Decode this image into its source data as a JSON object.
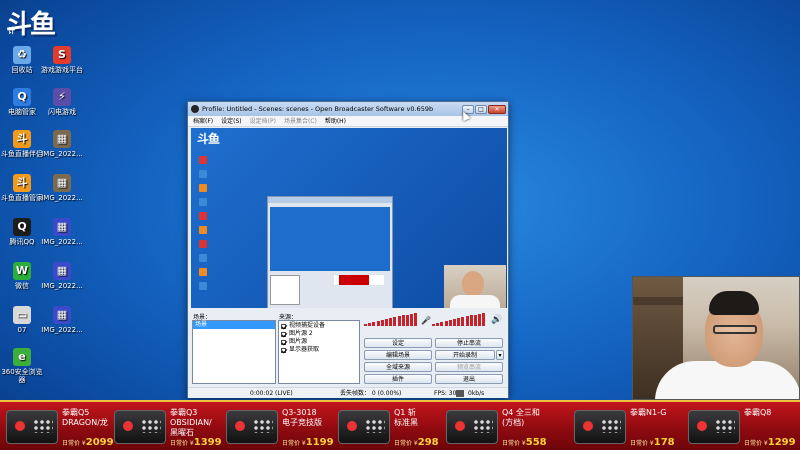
{
  "desktop": {
    "logo_text": "斗鱼",
    "logo_sub": "计",
    "icons": [
      {
        "label": "回收站",
        "icon": "recycle-bin-icon",
        "color": "#6aa8e8",
        "glyph": "♻"
      },
      {
        "label": "游戏游戏平台",
        "icon": "game-platform-icon",
        "color": "#e33c2c",
        "glyph": "S"
      },
      {
        "label": "电脑管家",
        "icon": "pc-manager-icon",
        "color": "#2e7de0",
        "glyph": "Q"
      },
      {
        "label": "闪电游戏",
        "icon": "lightning-game-icon",
        "color": "#5b4ea8",
        "glyph": "⚡"
      },
      {
        "label": "斗鱼直播伴侣",
        "icon": "douyu-companion-icon",
        "color": "#f39a1c",
        "glyph": "斗"
      },
      {
        "label": "IMG_2022...",
        "icon": "image-file-icon",
        "color": "#7a6a52",
        "glyph": "▦"
      },
      {
        "label": "斗鱼直播管家",
        "icon": "douyu-manager-icon",
        "color": "#f39a1c",
        "glyph": "斗"
      },
      {
        "label": "IMG_2022...",
        "icon": "image-file-icon",
        "color": "#7a6a52",
        "glyph": "▦"
      },
      {
        "label": "腾讯QQ",
        "icon": "qq-icon",
        "color": "#1d1d1d",
        "glyph": "Q"
      },
      {
        "label": "IMG_2022...",
        "icon": "image-file-icon",
        "color": "#3a4ac8",
        "glyph": "▦"
      },
      {
        "label": "微信",
        "icon": "wechat-icon",
        "color": "#2bae3c",
        "glyph": "W"
      },
      {
        "label": "IMG_2022...",
        "icon": "image-file-icon",
        "color": "#3a4ac8",
        "glyph": "▦"
      },
      {
        "label": "07",
        "icon": "folder-icon",
        "color": "#d8d8d8",
        "glyph": "▭"
      },
      {
        "label": "IMG_2022...",
        "icon": "image-file-icon",
        "color": "#3a4ac8",
        "glyph": "▦"
      },
      {
        "label": "360安全浏览器",
        "icon": "browser-360-icon",
        "color": "#3cae3c",
        "glyph": "e"
      }
    ]
  },
  "obs": {
    "title": "Profile: Untitled - Scenes: scenes - Open Broadcaster Software v0.659b",
    "menu": [
      {
        "label": "档案(F)",
        "disabled": false
      },
      {
        "label": "设定(S)",
        "disabled": false
      },
      {
        "label": "设定档(P)",
        "disabled": true
      },
      {
        "label": "场景集合(C)",
        "disabled": true
      },
      {
        "label": "帮助(H)",
        "disabled": false
      }
    ],
    "preview_logo": "斗鱼",
    "scenes_label": "场景：",
    "scenes": [
      "场景"
    ],
    "sources_label": "来源：",
    "sources": [
      "视频捕捉设备",
      "图片源 2",
      "图片源",
      "显示器获取"
    ],
    "buttons": {
      "settings": "设定",
      "stop_stream": "停止串流",
      "edit_scene": "编辑场景",
      "start_recording": "开始录制",
      "global_sources": "全域来源",
      "preview_stream": "预览串流",
      "plugins": "插件",
      "exit": "退出"
    },
    "status": {
      "time": "0:00:02 (LIVE)",
      "dropped_frames": "丢失帧数：  0 (0.00%)",
      "fps": "FPS: 30",
      "bitrate": "0kb/s"
    }
  },
  "ads": [
    {
      "name": "拳霸Q5\nDRAGON/龙",
      "price_label": "日常价 ¥",
      "price": "2099"
    },
    {
      "name": "拳霸Q3\nOBSIDIAN/\n黑曜石",
      "price_label": "日常价 ¥",
      "price": "1399"
    },
    {
      "name": "Q3-3018\n电子竞技版",
      "price_label": "日常价 ¥",
      "price": "1199"
    },
    {
      "name": "Q1 斩\n标准黑",
      "price_label": "日常价 ¥",
      "price": "298"
    },
    {
      "name": "Q4 全三和\n(方档)",
      "price_label": "日常价 ¥",
      "price": "558"
    },
    {
      "name": "拳霸N1-G",
      "price_label": "日常价 ¥",
      "price": "178"
    },
    {
      "name": "拳霸Q8",
      "price_label": "日常价 ¥",
      "price": "1299"
    }
  ]
}
